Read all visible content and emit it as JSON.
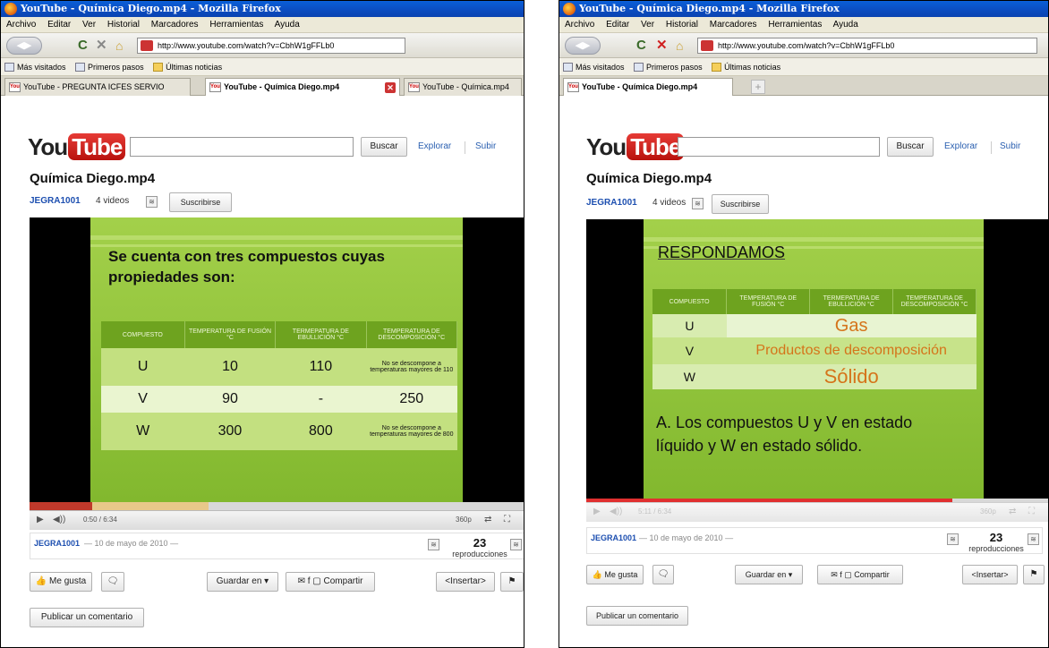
{
  "left": {
    "window_title": "YouTube - Química Diego.mp4 - Mozilla Firefox",
    "menu": [
      "Archivo",
      "Editar",
      "Ver",
      "Historial",
      "Marcadores",
      "Herramientas",
      "Ayuda"
    ],
    "url": "http://www.youtube.com/watch?v=CbhW1gFFLb0",
    "bookmarks": [
      "Más visitados",
      "Primeros pasos",
      "Últimas noticias"
    ],
    "tabs": [
      {
        "label": "YouTube - PREGUNTA ICFES SERVIO",
        "active": false
      },
      {
        "label": "YouTube - Química Diego.mp4",
        "active": true
      },
      {
        "label": "YouTube - Química.mp4",
        "active": false
      }
    ],
    "search_button": "Buscar",
    "explore": "Explorar",
    "upload": "Subir",
    "video_title": "Química Diego.mp4",
    "channel": "JEGRA1001",
    "video_count": "4 videos",
    "subscribe": "Suscribirse",
    "slide": {
      "heading": "Se cuenta con tres compuestos cuyas propiedades son:",
      "headers": [
        "COMPUESTO",
        "TEMPERATURA DE FUSIÓN °C",
        "TERMEPATURA DE EBULLICIÓN °C",
        "TEMPERATURA DE DESCOMPOSICIÓN °C"
      ],
      "rows": [
        [
          "U",
          "10",
          "110",
          "No se descompone a temperaturas mayores de 110"
        ],
        [
          "V",
          "90",
          "-",
          "250"
        ],
        [
          "W",
          "300",
          "800",
          "No se descompone a temperaturas mayores de 800"
        ]
      ]
    },
    "time": "0:50 / 6:34",
    "progress": 0.127,
    "quality": "360p",
    "uploader_line": "— 10 de mayo de 2010 —",
    "views_count": "23",
    "views_label": "reproducciones",
    "like": "Me gusta",
    "save": "Guardar en",
    "share": "Compartir",
    "embed": "<Insertar>",
    "comment": "Publicar un comentario"
  },
  "right": {
    "window_title": "YouTube - Química Diego.mp4 - Mozilla Firefox",
    "menu": [
      "Archivo",
      "Editar",
      "Ver",
      "Historial",
      "Marcadores",
      "Herramientas",
      "Ayuda"
    ],
    "url": "http://www.youtube.com/watch?v=CbhW1gFFLb0",
    "bookmarks": [
      "Más visitados",
      "Primeros pasos",
      "Últimas noticias"
    ],
    "tabs": [
      {
        "label": "YouTube - Química Diego.mp4",
        "active": true
      }
    ],
    "search_button": "Buscar",
    "explore": "Explorar",
    "upload": "Subir",
    "video_title": "Química Diego.mp4",
    "channel": "JEGRA1001",
    "video_count": "4 videos",
    "subscribe": "Suscribirse",
    "slide": {
      "heading": "RESPONDAMOS",
      "headers": [
        "COMPUESTO",
        "TEMPERATURA DE FUSIÓN °C",
        "TERMEPATURA DE EBULLICIÓN °C",
        "TEMPERATURA DE DESCOMPOSICIÓN °C"
      ],
      "rows": [
        "U",
        "V",
        "W"
      ],
      "states": [
        "Gas",
        "Productos de descomposición",
        "Sólido"
      ],
      "answer": "A. Los compuestos U y V en estado líquido y W en estado sólido."
    },
    "time": "5:11 / 6:34",
    "progress": 0.79,
    "quality": "360p",
    "uploader_line": "— 10 de mayo de 2010 —",
    "views_count": "23",
    "views_label": "reproducciones",
    "like": "Me gusta",
    "save": "Guardar en",
    "share": "Compartir",
    "embed": "<Insertar>",
    "comment": "Publicar un comentario"
  },
  "icons": [
    "firefox-icon",
    "back-icon",
    "forward-icon",
    "reload-icon",
    "stop-icon",
    "home-icon",
    "youtube-favicon",
    "play-icon",
    "volume-icon",
    "flag-icon",
    "thumbs-up-icon",
    "thumbs-down-icon",
    "fullscreen-icon",
    "popout-icon"
  ]
}
